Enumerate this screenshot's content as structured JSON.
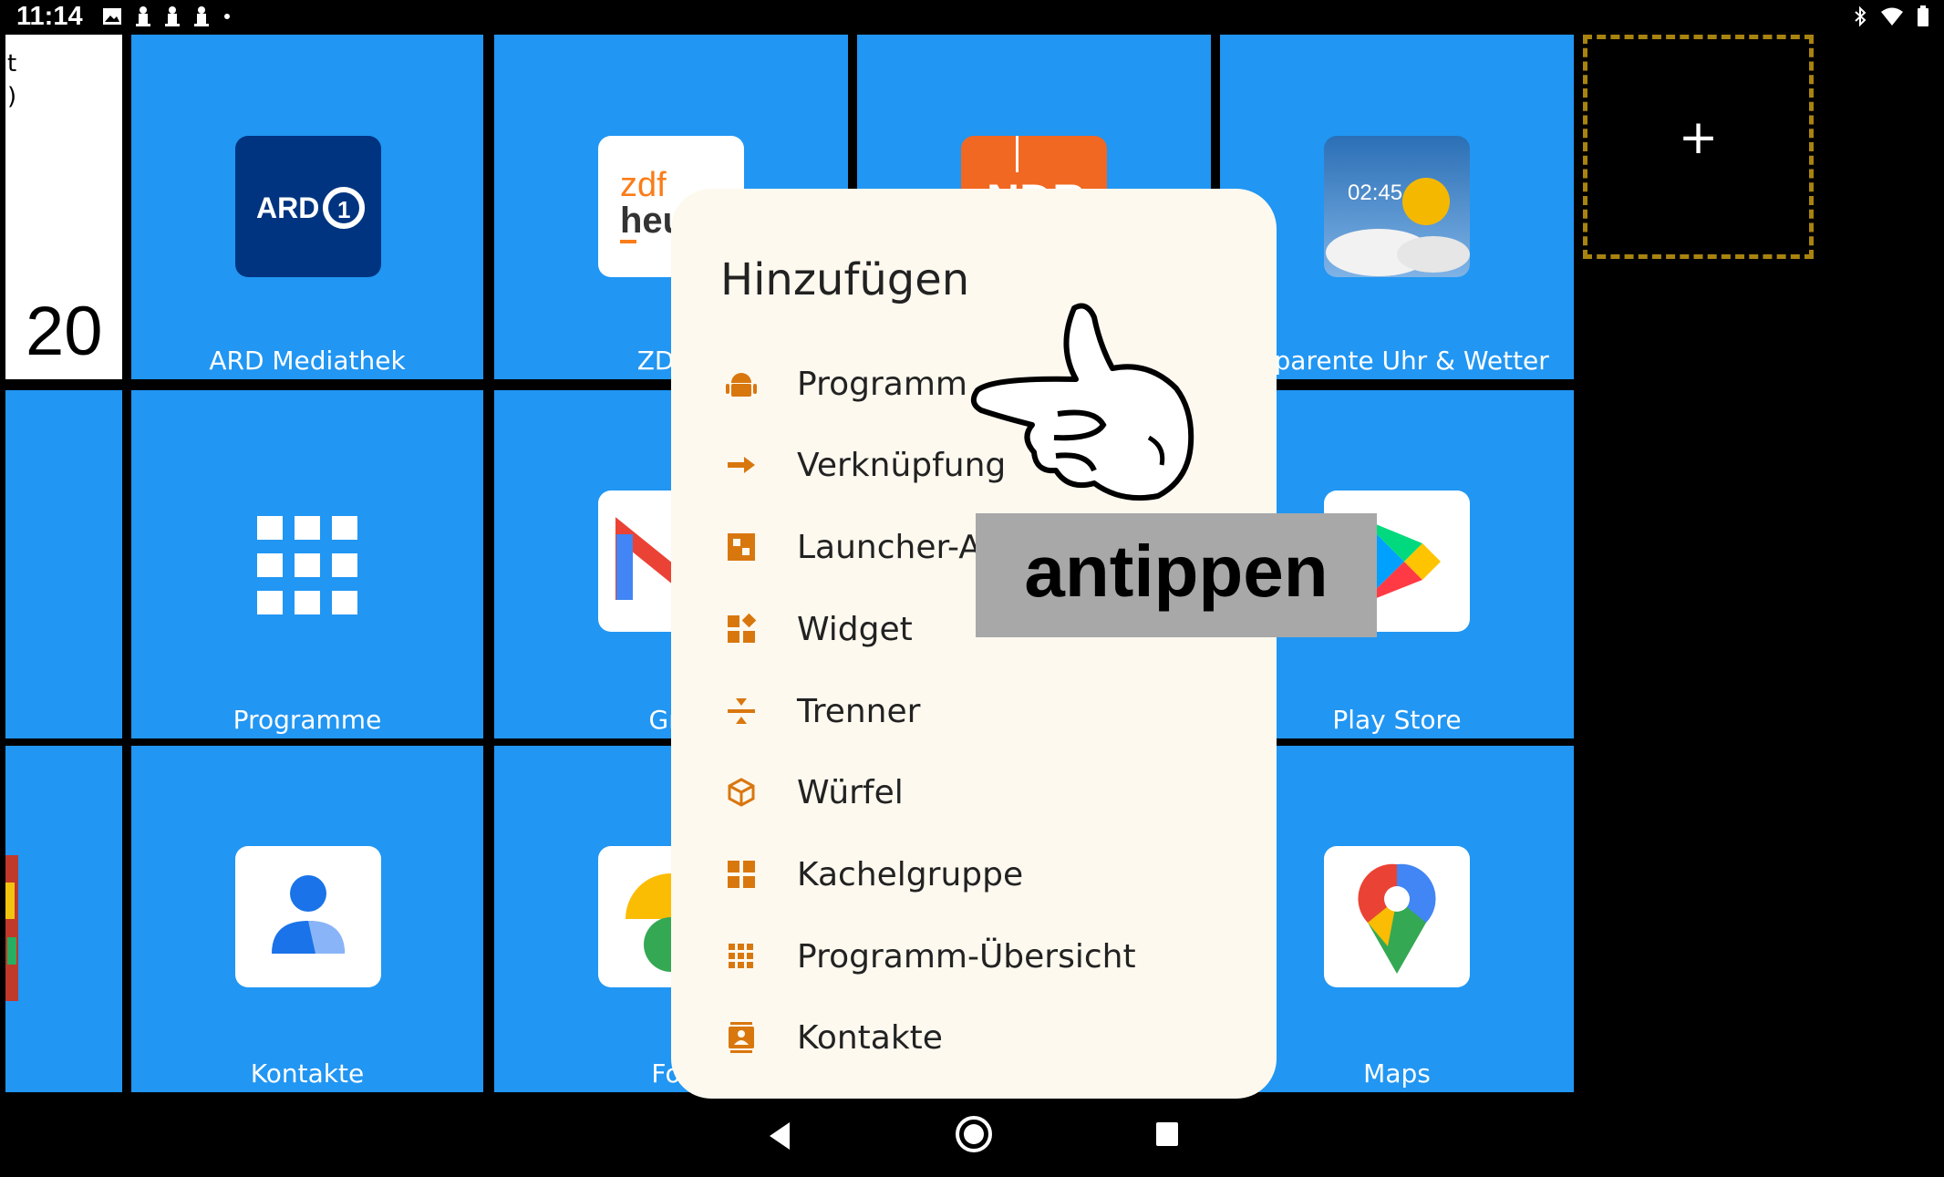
{
  "status_bar": {
    "time": "11:14",
    "left_icons": [
      "image-icon",
      "notification-icon",
      "notification-icon",
      "notification-icon",
      "dot-icon"
    ],
    "right_icons": [
      "bluetooth-icon",
      "wifi-icon",
      "battery-icon"
    ]
  },
  "clock_tile": {
    "text_lines": [
      "t",
      ")"
    ],
    "number": "20"
  },
  "tiles": [
    {
      "label": "ARD Mediathek",
      "icon": "ard-logo-icon"
    },
    {
      "label": "ZDFh",
      "icon": "zdf-heute-logo-icon"
    },
    {
      "label": "",
      "icon": "ndr-logo-icon"
    },
    {
      "label": "nsparente Uhr & Wetter",
      "icon": "weather-clock-icon"
    },
    {
      "label": "Programme",
      "icon": "app-grid-icon"
    },
    {
      "label": "Gm",
      "icon": "gmail-icon"
    },
    {
      "label": "Play Store",
      "icon": "play-store-icon"
    },
    {
      "label": "Kontakte",
      "icon": "contacts-icon"
    },
    {
      "label": "Fot",
      "icon": "photos-icon"
    },
    {
      "label": "Maps",
      "icon": "maps-icon"
    }
  ],
  "add_tile": {
    "symbol": "+"
  },
  "popup": {
    "title": "Hinzufügen",
    "items": [
      {
        "label": "Programm",
        "icon": "android-icon"
      },
      {
        "label": "Verknüpfung",
        "icon": "arrow-right-icon"
      },
      {
        "label": "Launcher-A",
        "icon": "launcher-action-icon"
      },
      {
        "label": "Widget",
        "icon": "widget-icon"
      },
      {
        "label": "Trenner",
        "icon": "separator-icon"
      },
      {
        "label": "Würfel",
        "icon": "cube-icon"
      },
      {
        "label": "Kachelgruppe",
        "icon": "tile-group-icon"
      },
      {
        "label": "Programm-Übersicht",
        "icon": "app-overview-icon"
      },
      {
        "label": "Kontakte",
        "icon": "contact-card-icon"
      }
    ]
  },
  "overlay": {
    "instruction": "antippen"
  },
  "nav_bar": {
    "buttons": [
      "back-icon",
      "home-icon",
      "recents-icon"
    ]
  },
  "colors": {
    "tile_blue": "#2196f3",
    "popup_background": "#fdf9ef",
    "menu_icon_orange": "#d9770f",
    "placeholder_border": "#a88310"
  }
}
